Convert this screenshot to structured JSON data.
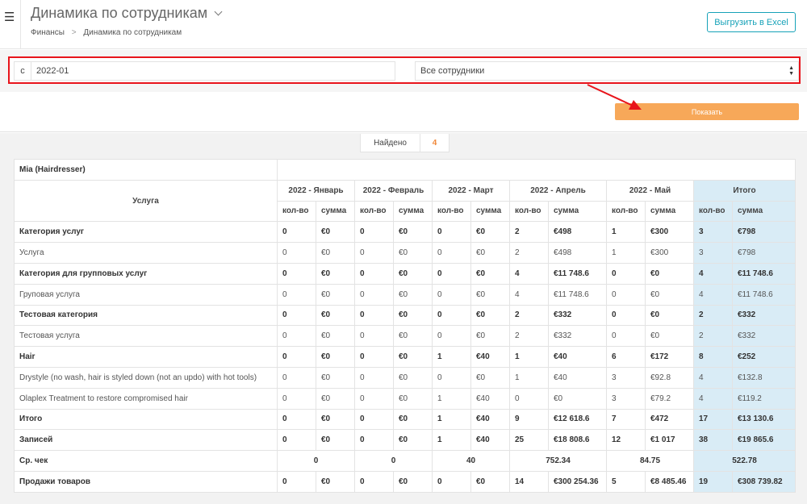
{
  "header": {
    "menu_icon": "hamburger-icon",
    "title": "Динамика по сотрудникам",
    "breadcrumb": [
      "Финансы",
      "Динамика по сотрудникам"
    ],
    "export_label": "Выгрузить в Excel"
  },
  "filter": {
    "prefix": "с",
    "date_value": "2022-01",
    "employee_value": "Все сотрудники"
  },
  "show_label": "Показать",
  "found": {
    "label": "Найдено",
    "count": "4"
  },
  "report": {
    "staff": "Mia (Hairdresser)",
    "service_header": "Услуга",
    "months": [
      "2022 - Январь",
      "2022 - Февраль",
      "2022 - Март",
      "2022 - Апрель",
      "2022 - Май"
    ],
    "total_header": "Итого",
    "sub_qty": "кол-во",
    "sub_sum": "сумма",
    "rows": [
      {
        "name": "Категория услуг",
        "bold": true,
        "cells": [
          "0",
          "€0",
          "0",
          "€0",
          "0",
          "€0",
          "2",
          "€498",
          "1",
          "€300",
          "3",
          "€798"
        ]
      },
      {
        "name": "Услуга",
        "bold": false,
        "cells": [
          "0",
          "€0",
          "0",
          "€0",
          "0",
          "€0",
          "2",
          "€498",
          "1",
          "€300",
          "3",
          "€798"
        ]
      },
      {
        "name": "Категория для групповых услуг",
        "bold": true,
        "cells": [
          "0",
          "€0",
          "0",
          "€0",
          "0",
          "€0",
          "4",
          "€11 748.6",
          "0",
          "€0",
          "4",
          "€11 748.6"
        ]
      },
      {
        "name": "Груповая услуга",
        "bold": false,
        "cells": [
          "0",
          "€0",
          "0",
          "€0",
          "0",
          "€0",
          "4",
          "€11 748.6",
          "0",
          "€0",
          "4",
          "€11 748.6"
        ]
      },
      {
        "name": "Тестовая категория",
        "bold": true,
        "cells": [
          "0",
          "€0",
          "0",
          "€0",
          "0",
          "€0",
          "2",
          "€332",
          "0",
          "€0",
          "2",
          "€332"
        ]
      },
      {
        "name": "Тестовая услуга",
        "bold": false,
        "cells": [
          "0",
          "€0",
          "0",
          "€0",
          "0",
          "€0",
          "2",
          "€332",
          "0",
          "€0",
          "2",
          "€332"
        ]
      },
      {
        "name": "Hair",
        "bold": true,
        "cells": [
          "0",
          "€0",
          "0",
          "€0",
          "1",
          "€40",
          "1",
          "€40",
          "6",
          "€172",
          "8",
          "€252"
        ]
      },
      {
        "name": "Drystyle (no wash, hair is styled down (not an updo) with hot tools)",
        "bold": false,
        "cells": [
          "0",
          "€0",
          "0",
          "€0",
          "0",
          "€0",
          "1",
          "€40",
          "3",
          "€92.8",
          "4",
          "€132.8"
        ]
      },
      {
        "name": "Olaplex Treatment to restore compromised hair",
        "bold": false,
        "cells": [
          "0",
          "€0",
          "0",
          "€0",
          "1",
          "€40",
          "0",
          "€0",
          "3",
          "€79.2",
          "4",
          "€119.2"
        ]
      },
      {
        "name": "Итого",
        "bold": true,
        "cells": [
          "0",
          "€0",
          "0",
          "€0",
          "1",
          "€40",
          "9",
          "€12 618.6",
          "7",
          "€472",
          "17",
          "€13 130.6"
        ]
      },
      {
        "name": "Записей",
        "bold": true,
        "cells": [
          "0",
          "€0",
          "0",
          "€0",
          "1",
          "€40",
          "25",
          "€18 808.6",
          "12",
          "€1 017",
          "38",
          "€19 865.6"
        ]
      },
      {
        "name": "Ср. чек",
        "bold": true,
        "merged": true,
        "cells": [
          "0",
          "0",
          "40",
          "752.34",
          "84.75",
          "522.78"
        ]
      },
      {
        "name": "Продажи товаров",
        "bold": true,
        "cells": [
          "0",
          "€0",
          "0",
          "€0",
          "0",
          "€0",
          "14",
          "€300 254.36",
          "5",
          "€8 485.46",
          "19",
          "€308 739.82"
        ]
      }
    ]
  }
}
